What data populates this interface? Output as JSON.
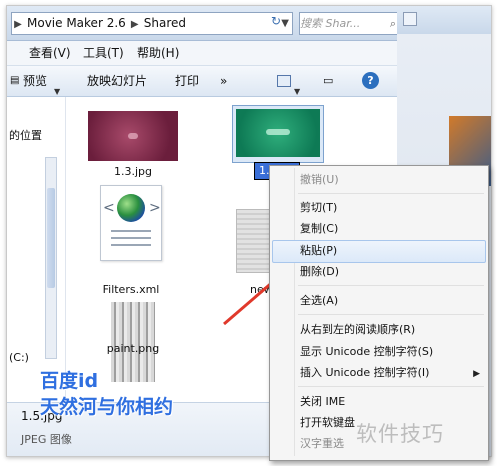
{
  "address": {
    "segments": [
      "Movie Maker 2.6",
      "Shared"
    ],
    "search_placeholder": "搜索 Shar..."
  },
  "menubar": {
    "items": [
      "查看(V)",
      "工具(T)",
      "帮助(H)"
    ]
  },
  "toolbar": {
    "preview": "预览",
    "slideshow": "放映幻灯片",
    "print": "打印",
    "more": "»"
  },
  "nav": {
    "location_text": "的位置",
    "drive_text": "(C:)"
  },
  "files": [
    {
      "name": "1.3.jpg"
    },
    {
      "name": "1.5"
    },
    {
      "name": "Filters.xml"
    },
    {
      "name": "new"
    },
    {
      "name": "paint.png"
    }
  ],
  "status": {
    "filename": "1.5.jpg",
    "filetype": "JPEG 图像"
  },
  "context_menu": {
    "items": [
      {
        "label": "撤销(U)",
        "enabled": false
      },
      {
        "label": "剪切(T)",
        "enabled": true
      },
      {
        "label": "复制(C)",
        "enabled": true
      },
      {
        "label": "粘贴(P)",
        "enabled": true,
        "highlighted": true
      },
      {
        "label": "删除(D)",
        "enabled": true
      },
      {
        "label": "全选(A)",
        "enabled": true
      },
      {
        "label": "从右到左的阅读顺序(R)",
        "enabled": true
      },
      {
        "label": "显示 Unicode 控制字符(S)",
        "enabled": true
      },
      {
        "label": "插入 Unicode 控制字符(I)",
        "enabled": true,
        "submenu": true
      },
      {
        "label": "关闭 IME",
        "enabled": true
      },
      {
        "label": "打开软键盘",
        "enabled": true
      },
      {
        "label": "汉字重选",
        "enabled": false
      }
    ],
    "submenu_arrow": "▶"
  },
  "watermark": {
    "title": "百度id",
    "subtitle": "天然河与你相约",
    "site": "软件技巧"
  },
  "colors": {
    "accent": "#2f6fe0",
    "arrow": "#e0392b",
    "highlight": "#dce9f9"
  }
}
